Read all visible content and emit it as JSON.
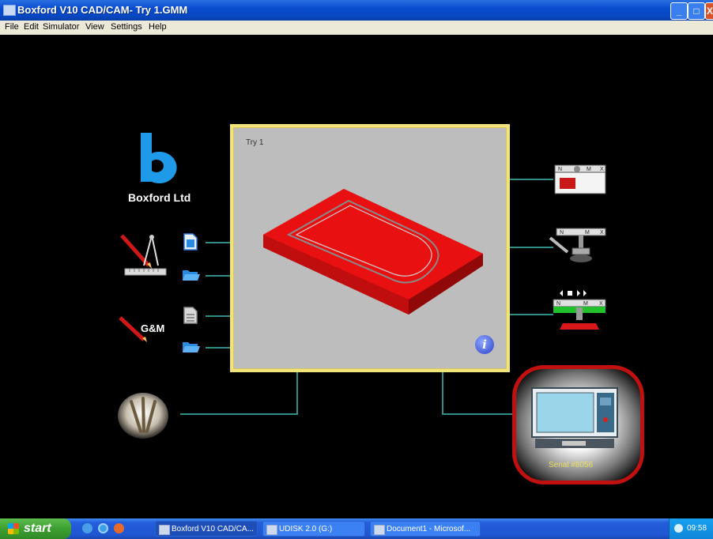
{
  "window": {
    "title": "Boxford V10 CAD/CAM- Try 1.GMM",
    "minimize_label": "_",
    "maximize_label": "□",
    "close_label": "X"
  },
  "menu": [
    "File",
    "Edit",
    "Simulator",
    "View",
    "Settings",
    "Help"
  ],
  "branding": {
    "company": "Boxford Ltd"
  },
  "left_tools": {
    "gm_label": "G&M"
  },
  "viewport": {
    "document_title": "Try 1"
  },
  "machine": {
    "serial": "Serial #8056"
  },
  "taskbar": {
    "start_label": "start",
    "tasks": [
      "Boxford V10 CAD/CA...",
      "UDISK 2.0 (G:)",
      "Document1 - Microsof..."
    ],
    "clock": "09:58"
  },
  "colors": {
    "accent_red": "#c01010",
    "frame_yellow": "#f0e47a",
    "xp_blue": "#0847c2",
    "part_red": "#e81010"
  }
}
